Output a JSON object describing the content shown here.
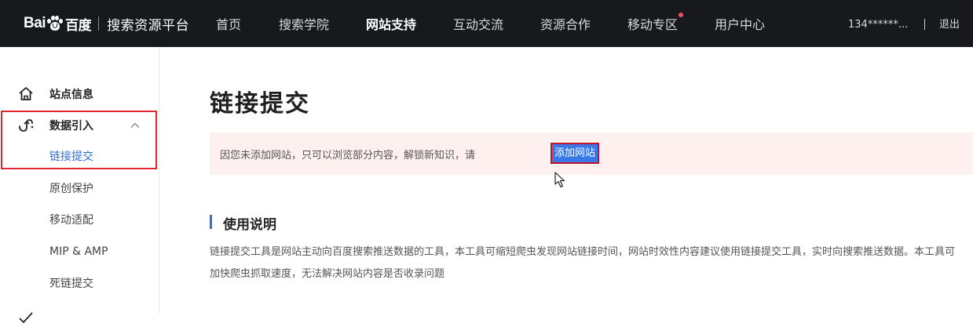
{
  "brand": {
    "logo_latin_left": "Bai",
    "logo_chinese": "百度",
    "title": "搜索资源平台"
  },
  "nav": {
    "items": [
      {
        "label": "首页",
        "active": false
      },
      {
        "label": "搜索学院",
        "active": false
      },
      {
        "label": "网站支持",
        "active": true
      },
      {
        "label": "互动交流",
        "active": false
      },
      {
        "label": "资源合作",
        "active": false
      },
      {
        "label": "移动专区",
        "active": false,
        "dot": true
      },
      {
        "label": "用户中心",
        "active": false
      }
    ]
  },
  "user": {
    "account": "134******...",
    "separator": "|",
    "logout_label": "退出"
  },
  "sidebar": {
    "site_info": {
      "label": "站点信息",
      "icon": "home-icon"
    },
    "data_import": {
      "label": "数据引入",
      "icon": "data-import-icon",
      "expanded": true
    },
    "sub_items": [
      {
        "label": "链接提交",
        "current": true
      },
      {
        "label": "原创保护",
        "current": false
      },
      {
        "label": "移动适配",
        "current": false
      },
      {
        "label": "MIP & AMP",
        "current": false
      },
      {
        "label": "死链提交",
        "current": false
      }
    ],
    "next_group": {
      "icon": "check-icon"
    }
  },
  "main": {
    "title": "链接提交",
    "notice": {
      "text": "因您未添加网站，只可以浏览部分内容，解锁新知识，请",
      "button_label": "添加网站"
    },
    "section": {
      "title": "使用说明",
      "description": "链接提交工具是网站主动向百度搜索推送数据的工具，本工具可缩短爬虫发现网站链接时间，网站时效性内容建议使用链接提交工具，实时向搜索推送数据。本工具可加快爬虫抓取速度，无法解决网站内容是否收录问题"
    }
  },
  "colors": {
    "topbar": "#17191c",
    "accent": "#2e6fd8",
    "highlight": "#e0262f",
    "notice_bg": "#fdf0ef",
    "button": "#3a78e8"
  }
}
